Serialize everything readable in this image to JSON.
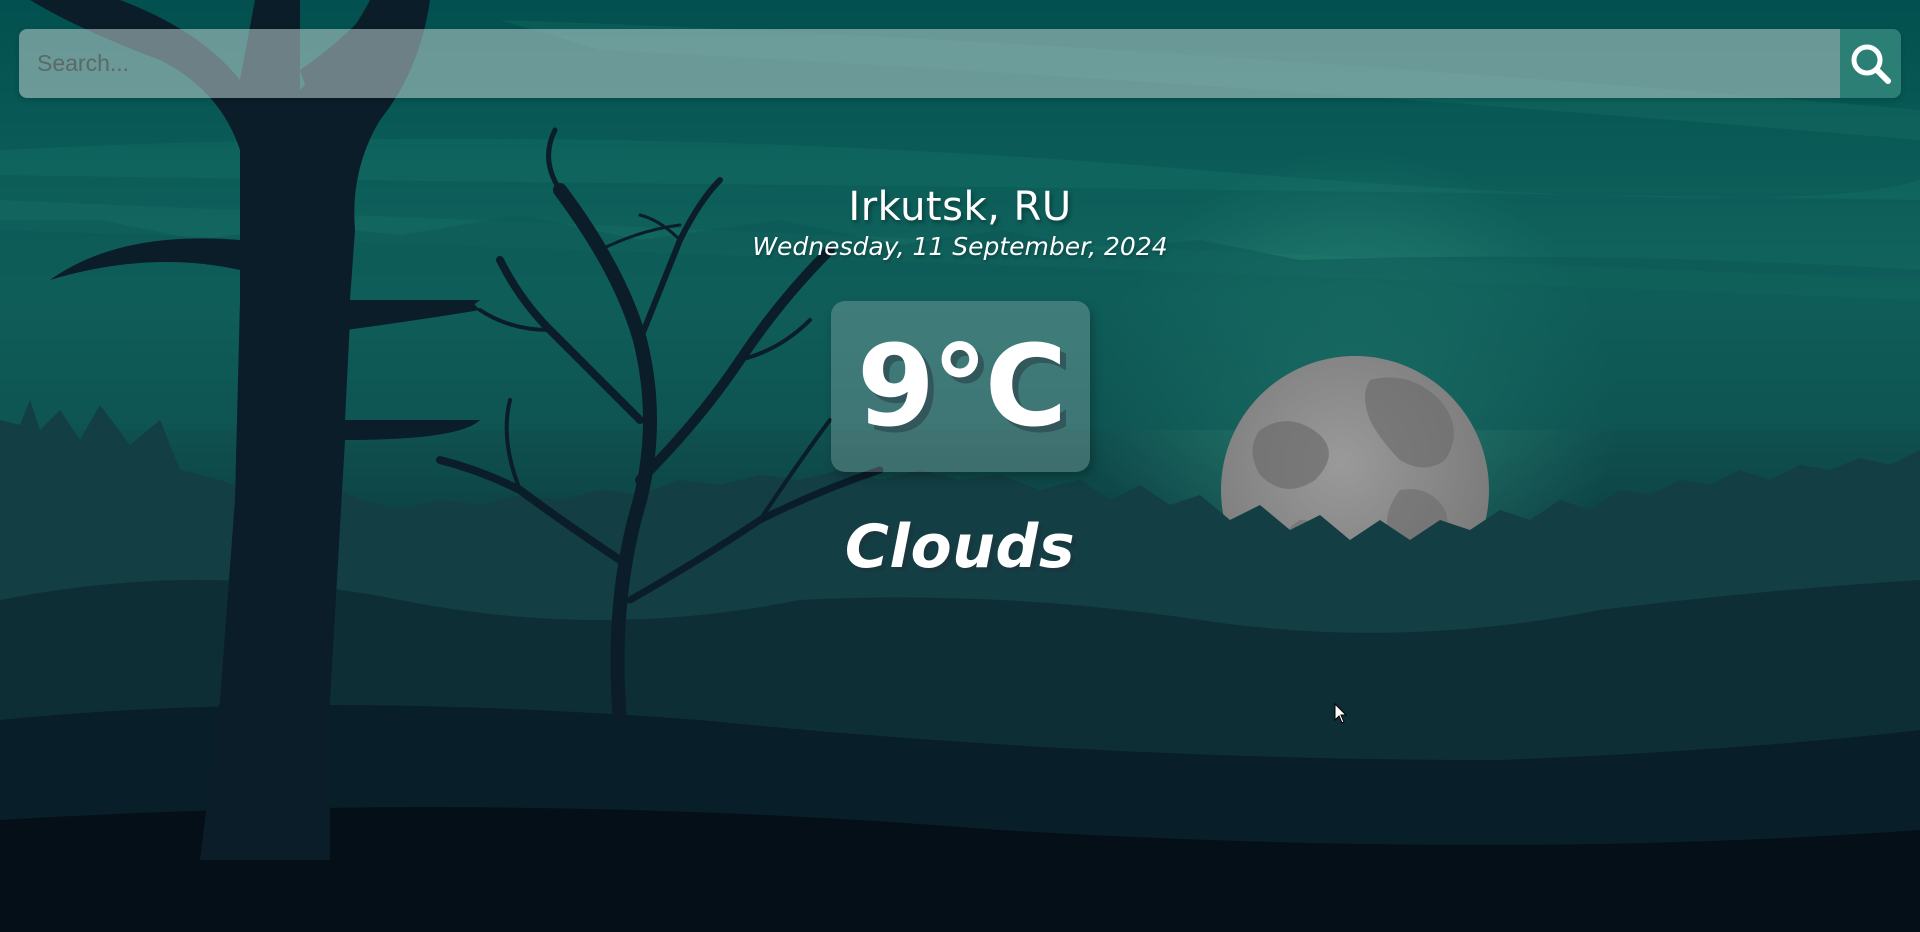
{
  "search": {
    "placeholder": "Search...",
    "button_icon": "search-icon"
  },
  "weather": {
    "location": "Irkutsk, RU",
    "date": "Wednesday, 11 September, 2024",
    "temperature": "9°C",
    "condition": "Clouds"
  },
  "colors": {
    "sky_top": "#02504f",
    "accent": "#2c7f74",
    "moon": "#8d8d8d",
    "foreground": "#071e27"
  },
  "background": {
    "scene": "night forest with bare trees and moon",
    "icons": [
      "tree-silhouette",
      "moon"
    ]
  }
}
